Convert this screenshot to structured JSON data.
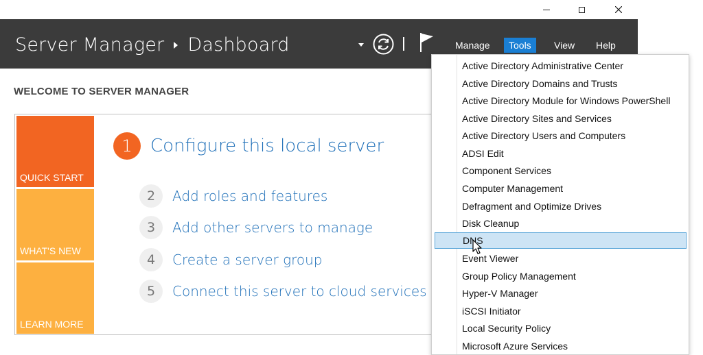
{
  "window": {
    "title": "Server Manager",
    "breadcrumb_page": "Dashboard",
    "controls": {
      "minimize_icon": "minimize-icon",
      "maximize_icon": "maximize-icon",
      "close_icon": "close-icon"
    }
  },
  "header": {
    "icons": [
      "dropdown-arrow-icon",
      "refresh-icon",
      "separator",
      "notifications-flag-icon"
    ],
    "menus": {
      "manage": "Manage",
      "tools": "Tools",
      "view": "View",
      "help": "Help"
    },
    "active_menu": "Tools",
    "background_color": "#3b3b3b",
    "active_menu_color": "#1a7fd4"
  },
  "welcome": {
    "title": "WELCOME TO SERVER MANAGER",
    "tiles": [
      "QUICK START",
      "WHAT'S NEW",
      "LEARN MORE"
    ],
    "tile_colors": {
      "quick_start": "#f26522",
      "whats_new": "#fdb040",
      "learn_more": "#fdb040"
    },
    "steps": [
      {
        "num": "1",
        "label": "Configure this local server"
      },
      {
        "num": "2",
        "label": "Add roles and features"
      },
      {
        "num": "3",
        "label": "Add other servers to manage"
      },
      {
        "num": "4",
        "label": "Create a server group"
      },
      {
        "num": "5",
        "label": "Connect this server to cloud services"
      }
    ]
  },
  "tools_menu": {
    "items": [
      "Active Directory Administrative Center",
      "Active Directory Domains and Trusts",
      "Active Directory Module for Windows PowerShell",
      "Active Directory Sites and Services",
      "Active Directory Users and Computers",
      "ADSI Edit",
      "Component Services",
      "Computer Management",
      "Defragment and Optimize Drives",
      "Disk Cleanup",
      "DNS",
      "Event Viewer",
      "Group Policy Management",
      "Hyper-V Manager",
      "iSCSI Initiator",
      "Local Security Policy",
      "Microsoft Azure Services"
    ],
    "highlighted_item": "DNS",
    "highlight_color": "#cde4f5"
  }
}
